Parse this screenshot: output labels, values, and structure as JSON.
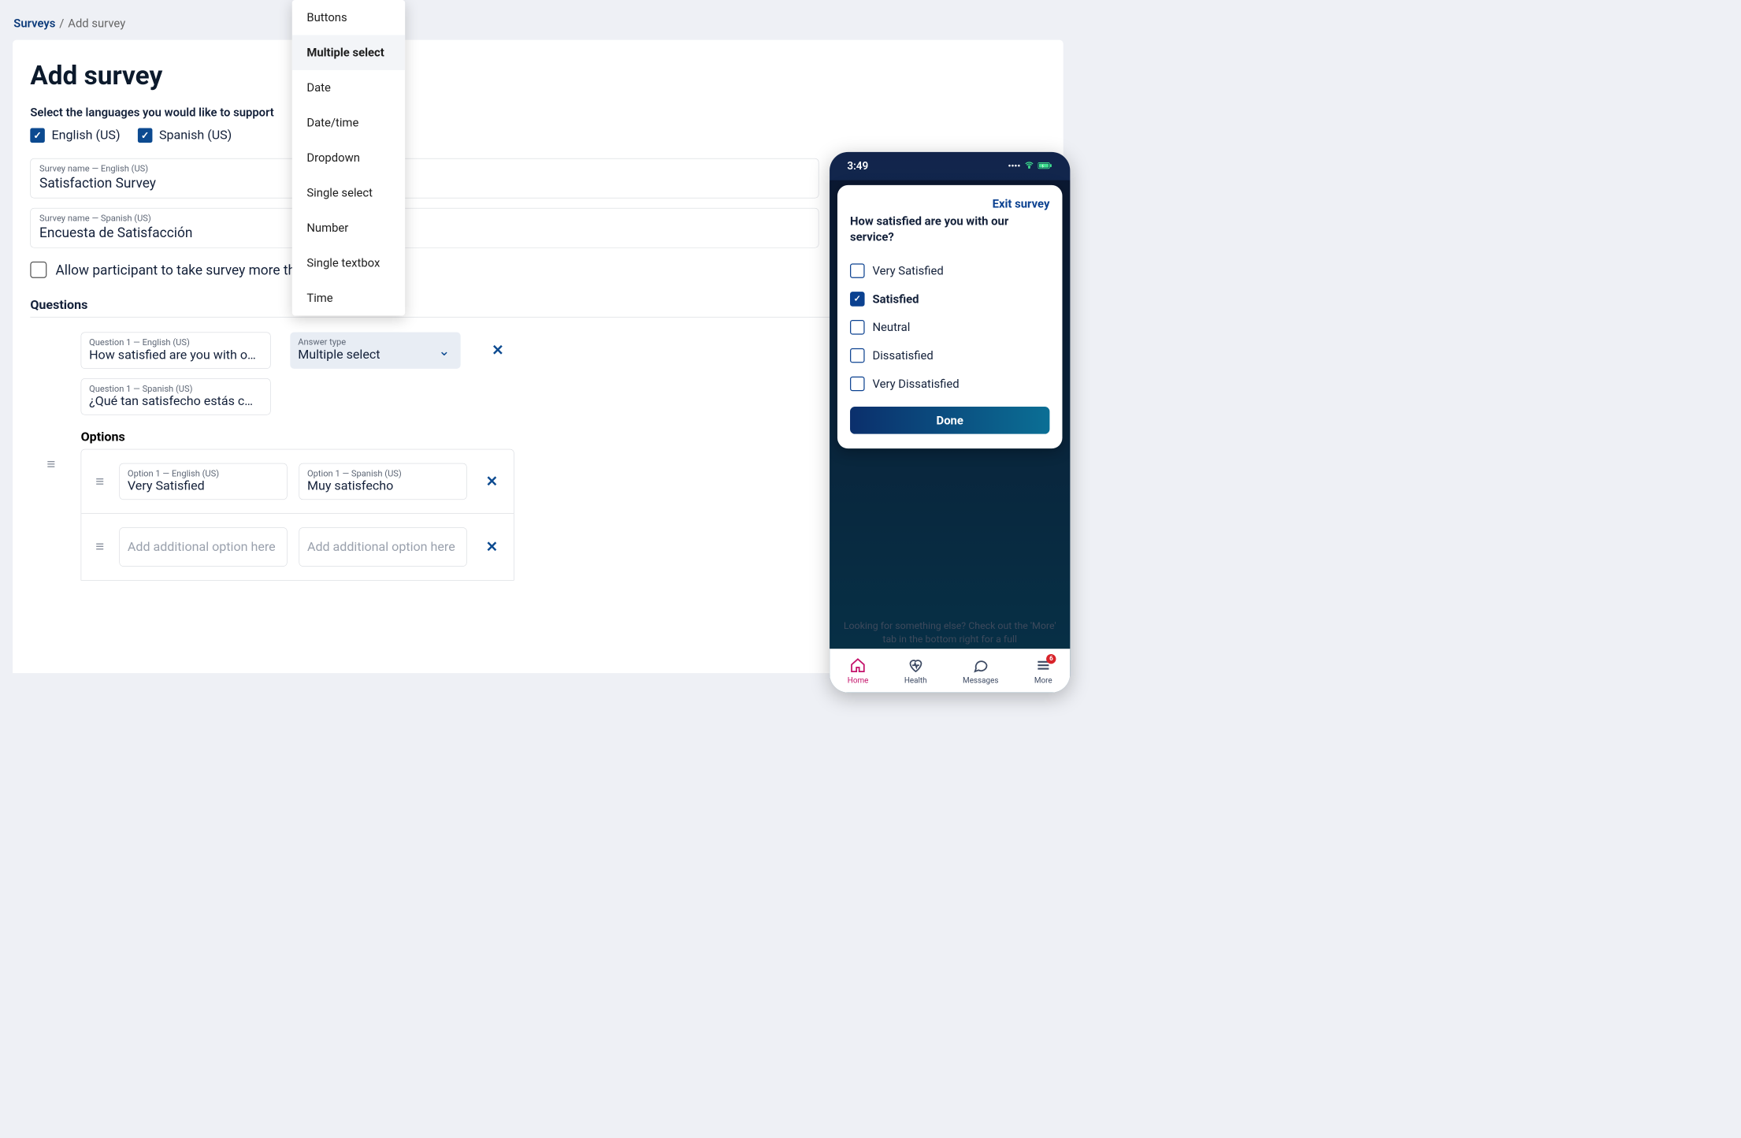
{
  "breadcrumb": {
    "root": "Surveys",
    "sep": "/",
    "current": "Add survey"
  },
  "page": {
    "title": "Add survey",
    "lang_label": "Select the languages you would like to support"
  },
  "languages": [
    {
      "label": "English (US)",
      "checked": true
    },
    {
      "label": "Spanish (US)",
      "checked": true
    }
  ],
  "survey_name": {
    "en_label": "Survey name — English (US)",
    "en_value": "Satisfaction Survey",
    "es_label": "Survey name — Spanish (US)",
    "es_value": "Encuesta de Satisfacción"
  },
  "allow_repeat": {
    "label": "Allow participant to take survey more than",
    "checked": false
  },
  "questions_title": "Questions",
  "question1": {
    "en_label": "Question 1 — English (US)",
    "en_value": "How satisfied are you with o…",
    "es_label": "Question 1 — Spanish (US)",
    "es_value": "¿Qué tan satisfecho estás c…",
    "answer_type_label": "Answer type",
    "answer_type_value": "Multiple select"
  },
  "answer_type_menu": {
    "items": [
      "Buttons",
      "Multiple select",
      "Date",
      "Date/time",
      "Dropdown",
      "Single select",
      "Number",
      "Single textbox",
      "Time"
    ],
    "selected": "Multiple select"
  },
  "options_title": "Options",
  "option1": {
    "en_label": "Option 1 — English (US)",
    "en_value": "Very Satisfied",
    "es_label": "Option 1 — Spanish (US)",
    "es_value": "Muy satisfecho"
  },
  "option_placeholder": "Add additional option here",
  "phone": {
    "time": "3:49",
    "exit": "Exit survey",
    "question": "How satisfied are you with our service?",
    "options": [
      {
        "label": "Very Satisfied",
        "checked": false
      },
      {
        "label": "Satisfied",
        "checked": true
      },
      {
        "label": "Neutral",
        "checked": false
      },
      {
        "label": "Dissatisfied",
        "checked": false
      },
      {
        "label": "Very Dissatisfied",
        "checked": false
      }
    ],
    "done": "Done",
    "hint": "Looking for something else? Check out the 'More' tab in the bottom right for a full",
    "tabs": {
      "home": "Home",
      "health": "Health",
      "messages": "Messages",
      "more": "More",
      "more_badge": "6"
    }
  }
}
